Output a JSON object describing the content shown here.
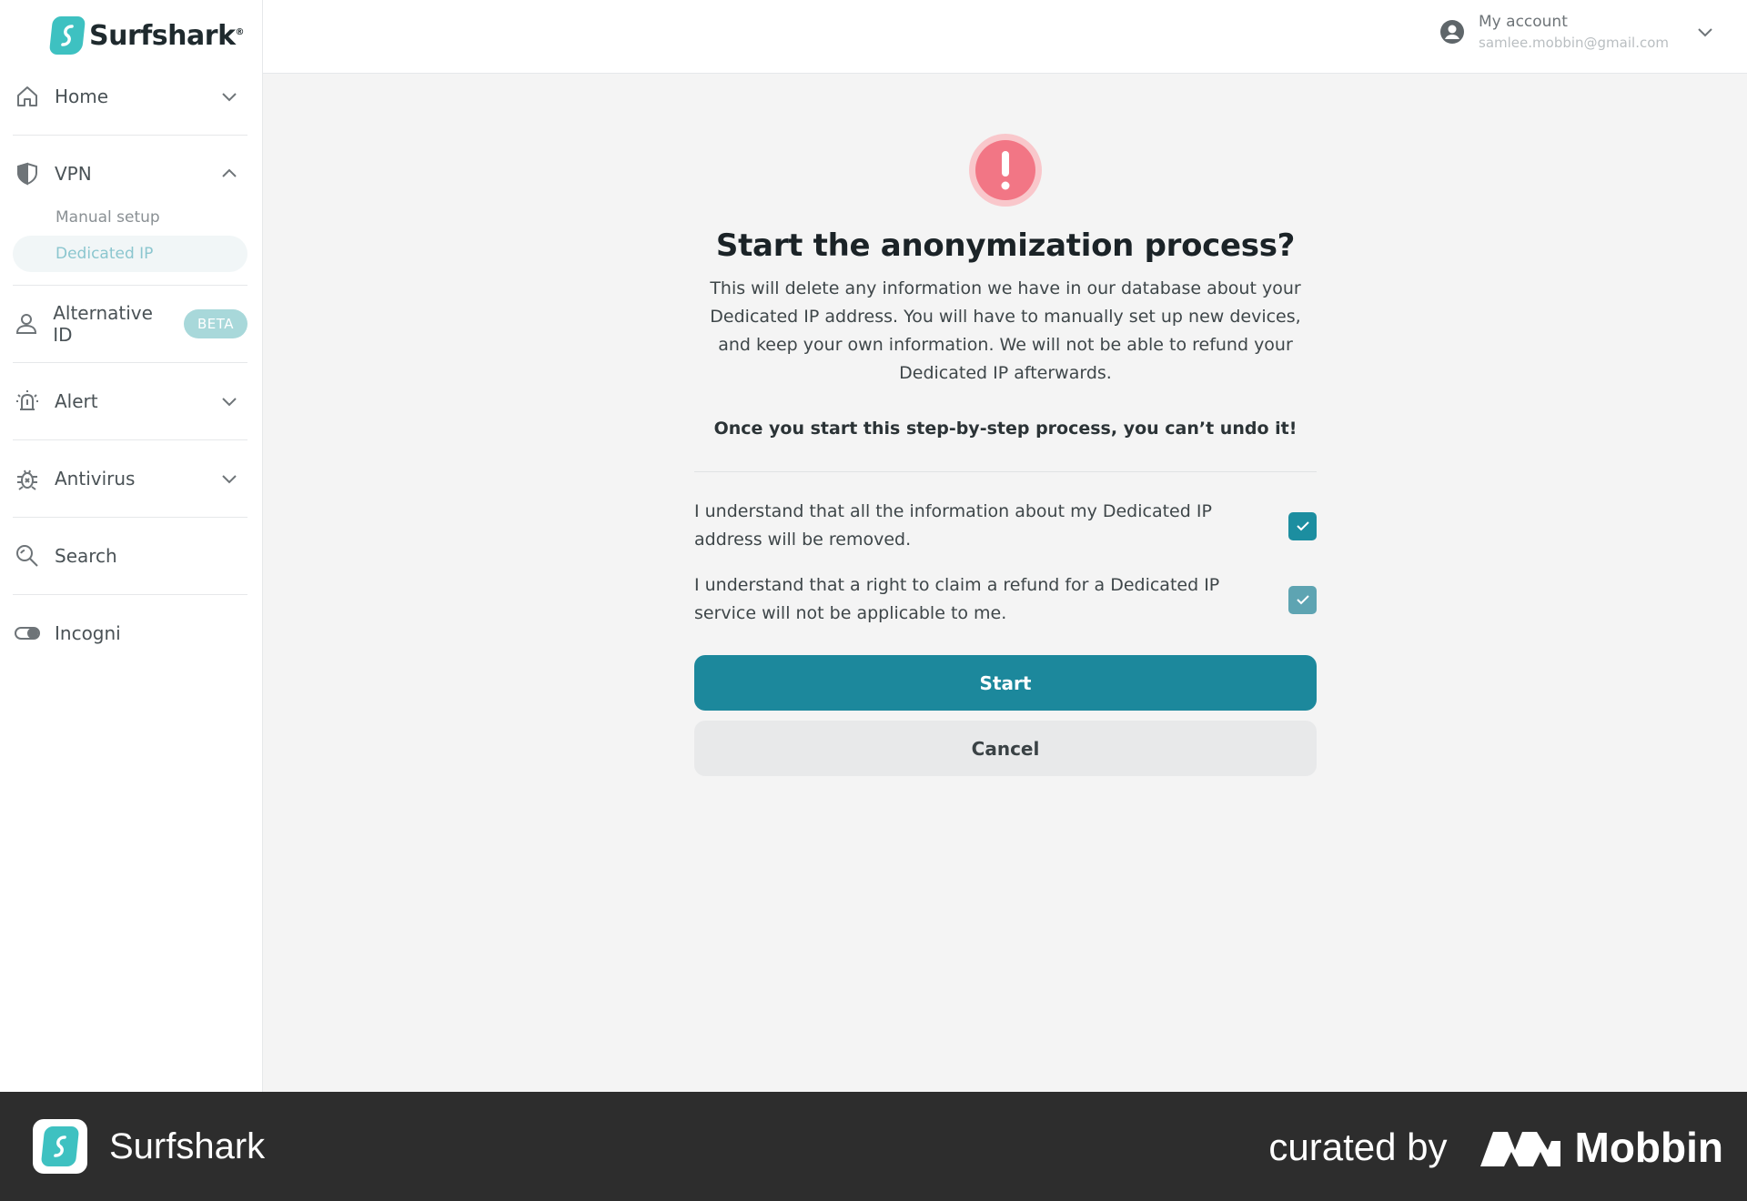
{
  "brand": {
    "name": "Surfshark",
    "reg": "®",
    "accent": "#1c889c",
    "logo_color": "#3ec1c1"
  },
  "sidebar": {
    "items": [
      {
        "label": "Home",
        "icon": "home-icon",
        "expanded": false
      },
      {
        "label": "VPN",
        "icon": "shield-icon",
        "expanded": true,
        "children": [
          {
            "label": "Manual setup"
          },
          {
            "label": "Dedicated IP",
            "active": true
          }
        ]
      },
      {
        "label": "Alternative ID",
        "icon": "person-icon",
        "badge": "BETA"
      },
      {
        "label": "Alert",
        "icon": "alert-bell-icon",
        "expanded": false
      },
      {
        "label": "Antivirus",
        "icon": "bug-icon",
        "expanded": false
      },
      {
        "label": "Search",
        "icon": "search-icon"
      },
      {
        "label": "Incogni",
        "icon": "toggle-icon"
      }
    ]
  },
  "header": {
    "account_label": "My account",
    "account_email": "samlee.mobbin@gmail.com"
  },
  "dialog": {
    "title": "Start the anonymization process?",
    "description": "This will delete any information we have in our database about your Dedicated IP address. You will have to manually set up new devices, and keep your own information. We will not be able to refund your Dedicated IP afterwards.",
    "warning": "Once you start this step-by-step process, you can’t undo it!",
    "checks": [
      {
        "text": "I understand that all the information about my Dedicated IP address will be removed.",
        "checked": true
      },
      {
        "text": "I understand that a right to claim a refund for a Dedicated IP service will not be applicable to me.",
        "checked": true
      }
    ],
    "start_label": "Start",
    "cancel_label": "Cancel"
  },
  "footer": {
    "app_name": "Surfshark",
    "curated_by": "curated by",
    "curator": "Mobbin"
  }
}
